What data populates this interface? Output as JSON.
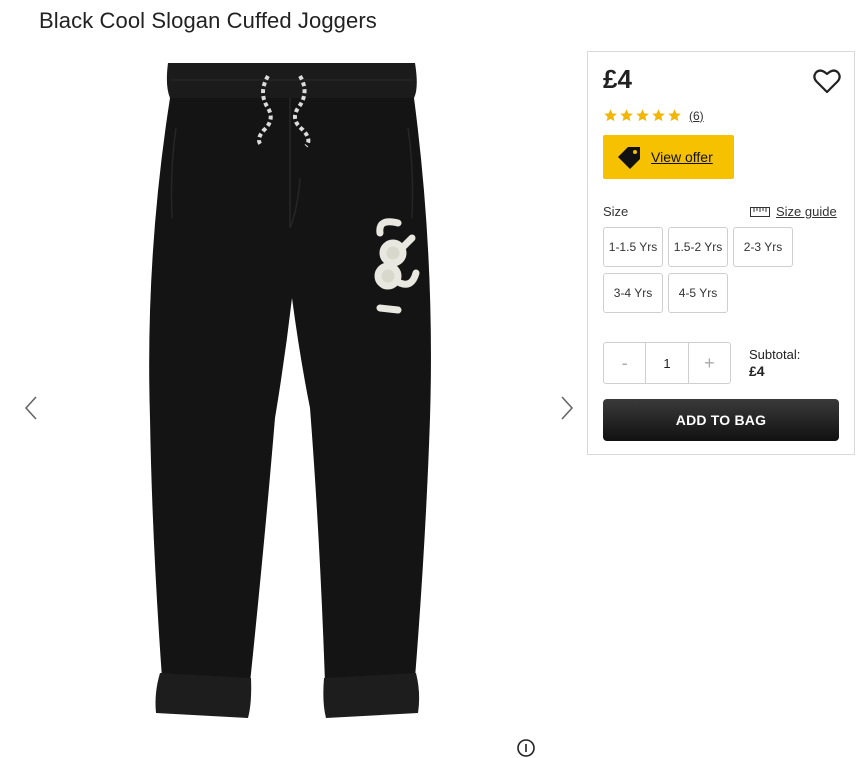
{
  "product": {
    "title": "Black Cool Slogan Cuffed Joggers",
    "image_name": "joggers-image",
    "slogan_graphic": "Cool"
  },
  "gallery": {
    "prev_icon": "chevron-left-icon",
    "next_icon": "chevron-right-icon",
    "zoom_icon": "zoom-icon"
  },
  "panel": {
    "price": "£4",
    "wishlist_icon": "heart-icon",
    "rating": {
      "stars": 5,
      "count_label": "(6)",
      "star_color": "#f2b705"
    },
    "offer": {
      "label": "View offer",
      "icon": "tag-icon",
      "color": "#f6c100"
    },
    "size": {
      "label": "Size",
      "guide_label": "Size guide",
      "guide_icon": "ruler-icon",
      "options": [
        "1-1.5 Yrs",
        "1.5-2 Yrs",
        "2-3 Yrs",
        "3-4 Yrs",
        "4-5 Yrs"
      ]
    },
    "quantity": {
      "minus": "-",
      "value": "1",
      "plus": "+"
    },
    "subtotal": {
      "label": "Subtotal:",
      "value": "£4"
    },
    "add_to_bag": "ADD TO BAG"
  }
}
